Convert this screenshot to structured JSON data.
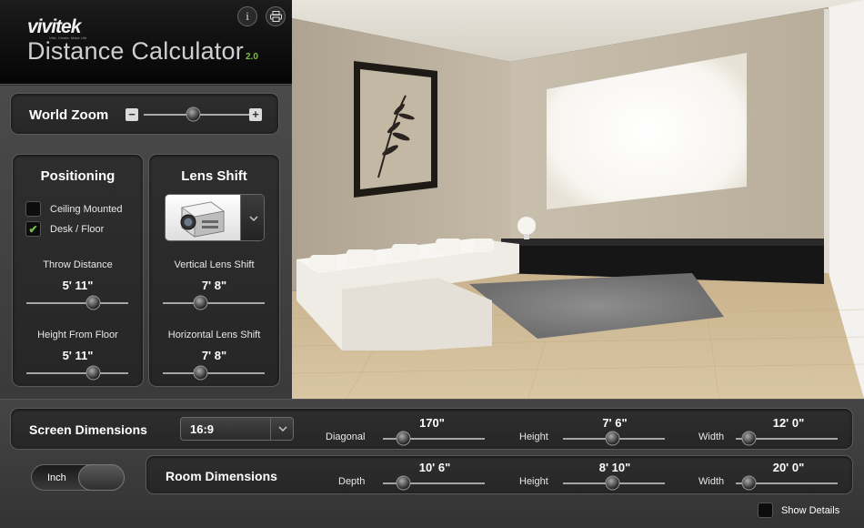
{
  "header": {
    "brand": "vivitek",
    "tagline": "Visit, Create, Make Life",
    "title": "Distance Calculator",
    "version": "2.0",
    "info_glyph": "i"
  },
  "world_zoom": {
    "label": "World Zoom",
    "minus": "−",
    "plus": "+",
    "level": 0.5
  },
  "positioning": {
    "title": "Positioning",
    "ceiling_mounted": {
      "label": "Ceiling Mounted",
      "checked": false
    },
    "desk_floor": {
      "label": "Desk / Floor",
      "checked": true,
      "mark": "✔"
    },
    "throw_distance": {
      "label": "Throw Distance",
      "value": "5' 11\"",
      "level": 0.65
    },
    "height_from_floor": {
      "label": "Height From Floor",
      "value": "5' 11\"",
      "level": 0.65
    }
  },
  "lens_shift": {
    "title": "Lens Shift",
    "dropdown_icon": "chevron-down-icon",
    "vertical": {
      "label": "Vertical Lens Shift",
      "value": "7' 8\"",
      "level": 0.35
    },
    "horizontal": {
      "label": "Horizontal Lens Shift",
      "value": "7' 8\"",
      "level": 0.35
    }
  },
  "screen_dimensions": {
    "title": "Screen Dimensions",
    "aspect_ratio": "16:9",
    "diagonal": {
      "label": "Diagonal",
      "value": "170\"",
      "level": 0.18
    },
    "height": {
      "label": "Height",
      "value": "7' 6\"",
      "level": 0.5
    },
    "width": {
      "label": "Width",
      "value": "12' 0\"",
      "level": 0.12
    }
  },
  "room_dimensions": {
    "title": "Room Dimensions",
    "depth": {
      "label": "Depth",
      "value": "10' 6\"",
      "level": 0.18
    },
    "height": {
      "label": "Height",
      "value": "8' 10\"",
      "level": 0.5
    },
    "width": {
      "label": "Width",
      "value": "20' 0\"",
      "level": 0.12
    }
  },
  "units": {
    "label": "Inch"
  },
  "show_details": {
    "label": "Show Details",
    "checked": false
  },
  "colors": {
    "accent_green": "#7cc142",
    "panel_dark": "#262626",
    "panel_mid": "#3a3a3a"
  }
}
